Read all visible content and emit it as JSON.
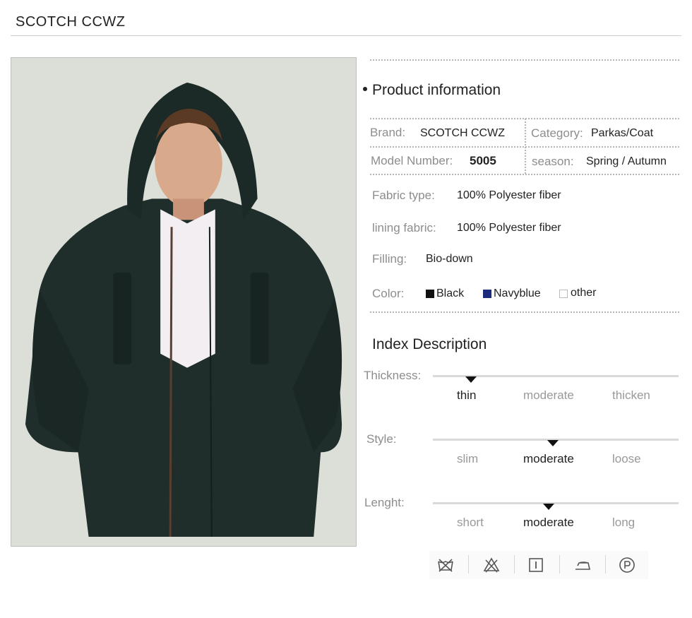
{
  "header": {
    "brand": "SCOTCH CCWZ"
  },
  "product_info": {
    "title": "Product information",
    "brand_label": "Brand:",
    "brand_value": "SCOTCH CCWZ",
    "category_label": "Category:",
    "category_value": "Parkas/Coat",
    "model_label": "Model Number:",
    "model_value": "5005",
    "season_label": "season:",
    "season_value": "Spring / Autumn",
    "fabric_label": "Fabric type:",
    "fabric_value": "100% Polyester fiber",
    "lining_label": "lining fabric:",
    "lining_value": "100% Polyester fiber",
    "filling_label": "Filling:",
    "filling_value": "Bio-down",
    "color_label": "Color:",
    "colors": [
      {
        "name": "Black",
        "swatch": "#111111"
      },
      {
        "name": "Navyblue",
        "swatch": "#1b2a7a"
      },
      {
        "name": "other",
        "swatch": "#ffffff"
      }
    ]
  },
  "index": {
    "title": "Index Description",
    "scales": [
      {
        "label": "Thickness:",
        "options": [
          "thin",
          "moderate",
          "thicken"
        ],
        "selected": "thin"
      },
      {
        "label": "Style:",
        "options": [
          "slim",
          "moderate",
          "loose"
        ],
        "selected": "moderate"
      },
      {
        "label": "Lenght:",
        "options": [
          "short",
          "moderate",
          "long"
        ],
        "selected": "moderate"
      }
    ]
  },
  "care_icons": [
    "no-wash-icon",
    "no-bleach-icon",
    "tumble-dry-icon",
    "iron-icon",
    "dry-clean-p-icon"
  ],
  "colors": {
    "jacket": "#1f2e2b",
    "photo_bg": "#dcdfd8",
    "navy": "#1b2a7a"
  }
}
